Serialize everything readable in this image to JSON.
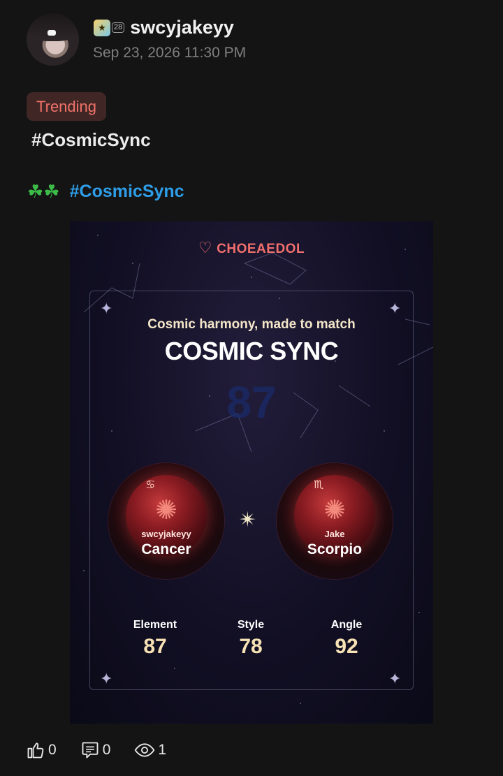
{
  "post": {
    "username": "swcyjakeyy",
    "level": "28",
    "timestamp": "Sep 23, 2026 11:30 PM",
    "tag": "Trending",
    "title": "#CosmicSync",
    "body_emoji": "☘☘",
    "body_hashtag": "#CosmicSync"
  },
  "card": {
    "brand": "CHOEAEDOL",
    "subtitle": "Cosmic harmony, made to match",
    "title": "COSMIC SYNC",
    "score": "87",
    "left": {
      "owner": "swcyjakeyy",
      "sign": "Cancer",
      "glyph": "♋"
    },
    "right": {
      "owner": "Jake",
      "sign": "Scorpio",
      "glyph": "♏"
    },
    "stats": [
      {
        "label": "Element",
        "value": "87"
      },
      {
        "label": "Style",
        "value": "78"
      },
      {
        "label": "Angle",
        "value": "92"
      }
    ]
  },
  "actions": {
    "likes": "0",
    "comments": "0",
    "views": "1"
  },
  "colors": {
    "accent": "#2e9ee8",
    "trending": "#f07268",
    "brand": "#f06f6c"
  }
}
